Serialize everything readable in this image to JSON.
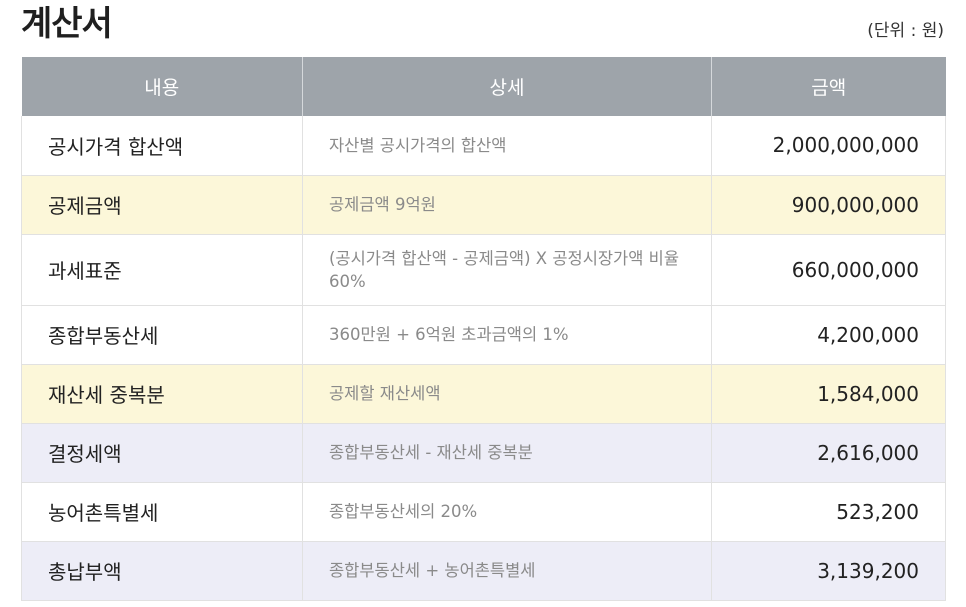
{
  "title": "계산서",
  "unit": "(단위 : 원)",
  "table": {
    "headers": [
      "내용",
      "상세",
      "금액"
    ],
    "rows": [
      {
        "item": "공시가격 합산액",
        "detail": "자산별 공시가격의 합산액",
        "amount": "2,000,000,000"
      },
      {
        "item": "공제금액",
        "detail": "공제금액 9억원",
        "amount": "900,000,000"
      },
      {
        "item": "과세표준",
        "detail": "(공시가격 합산액 - 공제금액) X 공정시장가액 비율 60%",
        "amount": "660,000,000"
      },
      {
        "item": "종합부동산세",
        "detail": "360만원 + 6억원 초과금액의 1%",
        "amount": "4,200,000"
      },
      {
        "item": "재산세 중복분",
        "detail": "공제할 재산세액",
        "amount": "1,584,000"
      },
      {
        "item": "결정세액",
        "detail": "종합부동산세 - 재산세 중복분",
        "amount": "2,616,000"
      },
      {
        "item": "농어촌특별세",
        "detail": "종합부동산세의 20%",
        "amount": "523,200"
      },
      {
        "item": "총납부액",
        "detail": "종합부동산세 + 농어촌특별세",
        "amount": "3,139,200"
      }
    ]
  },
  "colors": {
    "header_bg": "#9ea4aa",
    "highlight_yellow": "#fcf7d9",
    "highlight_lavender": "#ededf7"
  }
}
